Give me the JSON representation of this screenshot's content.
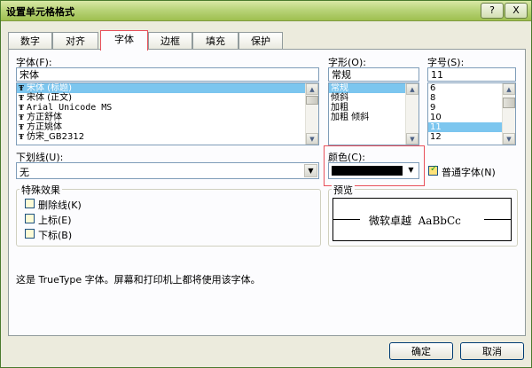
{
  "window": {
    "title": "设置单元格格式",
    "help_label": "?",
    "close_label": "X"
  },
  "tabs": [
    {
      "label": "数字"
    },
    {
      "label": "对齐"
    },
    {
      "label": "字体",
      "active": true
    },
    {
      "label": "边框"
    },
    {
      "label": "填充"
    },
    {
      "label": "保护"
    }
  ],
  "font": {
    "label": "字体(F):",
    "value": "宋体",
    "items": [
      "宋体 (标题)",
      "宋体 (正文)",
      "Arial Unicode MS",
      "方正舒体",
      "方正姚体",
      "仿宋_GB2312"
    ],
    "selected_index": 0
  },
  "style": {
    "label": "字形(O):",
    "value": "常规",
    "items": [
      "常规",
      "倾斜",
      "加粗",
      "加粗 倾斜"
    ],
    "selected_index": 0
  },
  "size": {
    "label": "字号(S):",
    "value": "11",
    "items": [
      "6",
      "8",
      "9",
      "10",
      "11",
      "12"
    ],
    "selected_index": 4
  },
  "underline": {
    "label": "下划线(U):",
    "value": "无"
  },
  "color": {
    "label": "颜色(C):",
    "swatch_color": "#000000"
  },
  "normal_font": {
    "label": "普通字体(N)",
    "checked": true
  },
  "effects": {
    "title": "特殊效果",
    "items": [
      {
        "label": "删除线(K)",
        "checked": false
      },
      {
        "label": "上标(E)",
        "checked": false
      },
      {
        "label": "下标(B)",
        "checked": false
      }
    ]
  },
  "preview": {
    "title": "预览",
    "sample_text": "微软卓越  AaBbCc"
  },
  "info_text": "这是 TrueType 字体。屏幕和打印机上都将使用该字体。",
  "buttons": {
    "ok": "确定",
    "cancel": "取消"
  },
  "colors": {
    "selection": "#7cc6ef",
    "highlight_border": "#e8505a",
    "titlebar": "#b9d47a"
  }
}
